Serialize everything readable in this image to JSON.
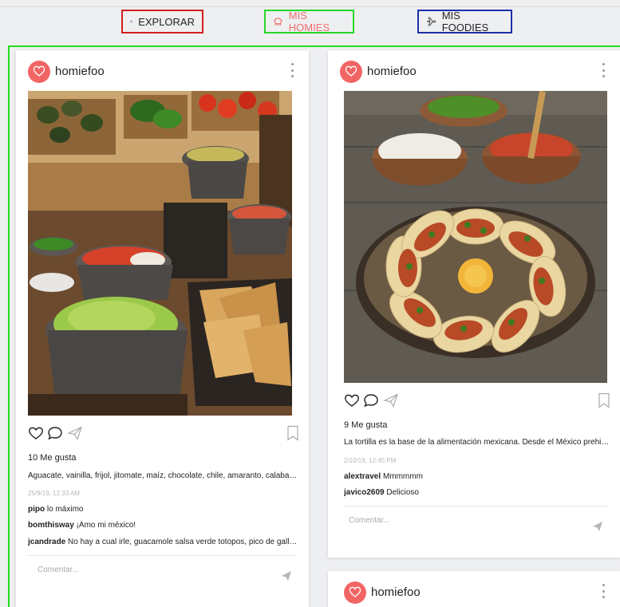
{
  "tabs": {
    "explorar": "EXPLORAR",
    "homies": "MIS HOMIES",
    "foodies": "MIS FOODIES"
  },
  "colors": {
    "explorar_border": "#d21e1e",
    "homies_border": "#27d827",
    "foodies_border": "#1b2fa8",
    "brand": "#f26565",
    "feed_frame": "#1fe01f"
  },
  "posts": [
    {
      "username": "homiefoo",
      "photo": "molcajetes-guacamole-salsas",
      "likes": "10 Me gusta",
      "caption": "Aguacate, vainilla, frijol, jitomate, maíz, chocolate, chile, amaranto, calabaza...",
      "time": "25/9/19, 12:33 AM",
      "comments": [
        {
          "user": "pipo",
          "text": "lo máximo"
        },
        {
          "user": "bomthisway",
          "text": "¡Amo mi méxico!"
        },
        {
          "user": "jcandrade",
          "text": "No hay a cual irle, guacamole salsa verde totopos, pico de gallo..."
        }
      ],
      "comment_placeholder": "Comentar..."
    },
    {
      "username": "homiefoo",
      "photo": "tacos-plate-salsas",
      "likes": "9 Me gusta",
      "caption": "La tortilla es la base de la alimentación mexicana. Desde el México prehispánico...",
      "time": "2/10/19, 12:45 PM",
      "comments": [
        {
          "user": "alextravel",
          "text": "Mmmmmm"
        },
        {
          "user": "javico2609",
          "text": "Delicioso"
        }
      ],
      "comment_placeholder": "Comentar..."
    },
    {
      "username": "homiefoo"
    }
  ],
  "icons": {
    "explorar": "compass-icon",
    "homies": "chef-hat-icon",
    "foodies": "airplane-icon",
    "like": "heart-icon",
    "comment": "comment-bubble-icon",
    "share": "send-icon",
    "save": "bookmark-icon",
    "more": "more-vertical-icon"
  }
}
